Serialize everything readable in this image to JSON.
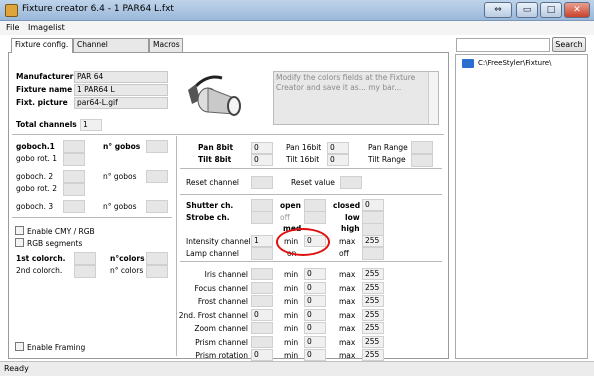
{
  "window": {
    "title": "Fixture creator 6.4 - 1 PAR64 L.fxt",
    "minimize": "▭",
    "maximize": "□",
    "close": "✕",
    "restore": "⇔"
  },
  "menu": [
    "File",
    "Imagelist"
  ],
  "tabs": [
    "Fixture config.",
    "Channel description",
    "Macros"
  ],
  "fixture": {
    "manufacturer_label": "Manufacturer",
    "manufacturer": "PAR 64",
    "name_label": "Fixture name",
    "name": "1 PAR64 L",
    "picture_label": "Fixt. picture",
    "picture": "par64-L.gif",
    "total_label": "Total channels",
    "total": "1"
  },
  "hint": "Modify the colors fields at the Fixture Creator and save it as... my bar...",
  "gobos": {
    "goboch1": "goboch.1",
    "ngobos_bold": "n° gobos",
    "gobo_rot1": "gobo rot. 1",
    "goboch2": "goboch. 2",
    "ngobos2": "n° gobos",
    "gobo_rot2": "gobo rot. 2",
    "goboch3": "goboch. 3",
    "ngobos3": "n° gobos"
  },
  "color": {
    "enable_cmy": "Enable CMY / RGB",
    "rgb_segments": "RGB segments",
    "colorch1": "1st colorch.",
    "ncolors_bold": "n°colors",
    "colorch2": "2nd colorch.",
    "ncolors": "n° colors",
    "enable_framing": "Enable Framing"
  },
  "pantilt": {
    "pan8": "Pan 8bit",
    "pan8_val": "0",
    "tilt8": "Tilt 8bit",
    "tilt8_val": "0",
    "pan16": "Pan 16bit",
    "pan16_val": "0",
    "tilt16": "Tilt 16bit",
    "tilt16_val": "0",
    "pan_range": "Pan Range",
    "tilt_range": "Tilt Range"
  },
  "reset": {
    "channel": "Reset channel",
    "value": "Reset value"
  },
  "shutter": {
    "shutter_ch": "Shutter ch.",
    "strobe_ch": "Strobe ch.",
    "open": "open",
    "off": "off",
    "med": "med",
    "closed": "closed",
    "closed_val": "0",
    "low": "low",
    "high": "high"
  },
  "intensity": {
    "label": "Intensity channel",
    "channel": "1",
    "min": "min",
    "min_val": "0",
    "max": "max",
    "max_val": "255",
    "lamp": "Lamp channel",
    "on": "on",
    "off": "off"
  },
  "channels": [
    {
      "label": "Iris channel",
      "ch": "",
      "min": "0",
      "max": "255"
    },
    {
      "label": "Focus channel",
      "ch": "",
      "min": "0",
      "max": "255"
    },
    {
      "label": "Frost channel",
      "ch": "",
      "min": "0",
      "max": "255"
    },
    {
      "label": "2nd. Frost channel",
      "ch": "0",
      "min": "0",
      "max": "255"
    },
    {
      "label": "Zoom channel",
      "ch": "",
      "min": "0",
      "max": "255"
    },
    {
      "label": "Prism channel",
      "ch": "",
      "min": "0",
      "max": "255"
    },
    {
      "label": "Prism rotation",
      "ch": "0",
      "min": "0",
      "max": "255"
    }
  ],
  "range_labels": {
    "min": "min",
    "max": "max"
  },
  "right": {
    "search": "Search",
    "folder": "C:\\FreeStyler\\Fixture\\"
  },
  "status": "Ready",
  "colors": {
    "highlight_circle": "#e01010",
    "folder": "#2a6fd0"
  }
}
